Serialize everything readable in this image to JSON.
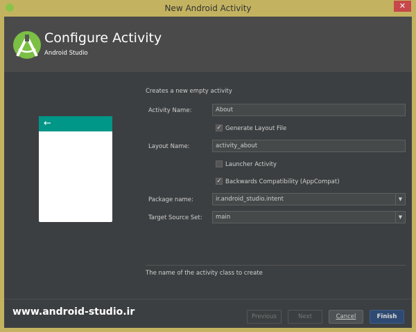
{
  "window": {
    "title": "New Android Activity",
    "close": "✕"
  },
  "header": {
    "title": "Configure Activity",
    "subtitle": "Android Studio"
  },
  "preview": {
    "back_arrow": "←",
    "accent": "#009688"
  },
  "form": {
    "description": "Creates a new empty activity",
    "activity_name_label": "Activity Name:",
    "activity_name": "About",
    "generate_layout": {
      "label": "Generate Layout File",
      "checked": true
    },
    "layout_name_label": "Layout Name:",
    "layout_name": "activity_about",
    "launcher": {
      "label": "Launcher Activity",
      "checked": false
    },
    "backwards": {
      "label": "Backwards Compatibility (AppCompat)",
      "checked": true
    },
    "package_label": "Package name:",
    "package": "ir.android_studio.intent",
    "source_set_label": "Target Source Set:",
    "source_set": "main",
    "help": "The name of the activity class to create",
    "check": "✓",
    "dropdown_arrow": "▼"
  },
  "footer": {
    "watermark": "www.android-studio.ir",
    "previous": "Previous",
    "next": "Next",
    "cancel": "Cancel",
    "finish": "Finish"
  }
}
